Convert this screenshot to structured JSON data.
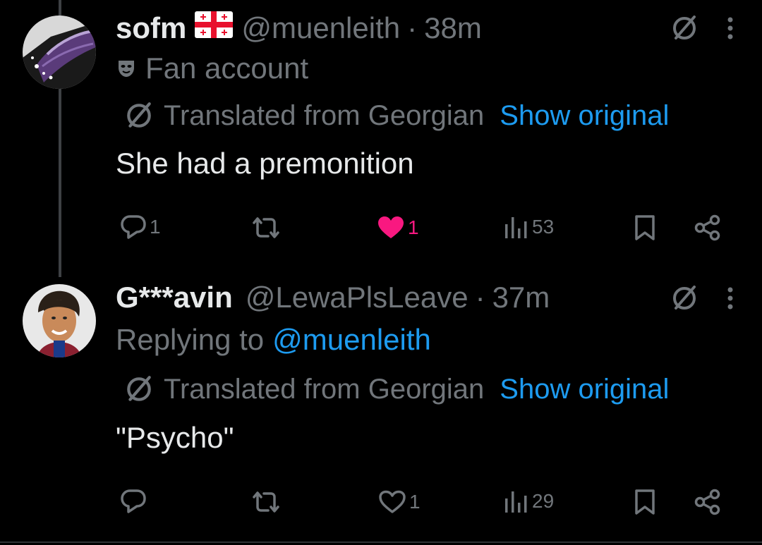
{
  "tweets": [
    {
      "name": "sofm",
      "handle": "@muenleith",
      "time": "38m",
      "badge_label": "Fan account",
      "translated": "Translated from Georgian",
      "show_original": "Show original",
      "text": "She had a premonition",
      "replies": "1",
      "retweets": "",
      "likes": "1",
      "liked": true,
      "views": "53"
    },
    {
      "name": "G***avin",
      "handle": "@LewaPlsLeave",
      "time": "37m",
      "replying_prefix": "Replying to",
      "replying_to": "@muenleith",
      "translated": "Translated from Georgian",
      "show_original": "Show original",
      "text": "\"Psycho\"",
      "replies": "",
      "retweets": "",
      "likes": "1",
      "liked": false,
      "views": "29"
    }
  ],
  "separator": "·",
  "colors": {
    "accent": "#1d9bf0",
    "like": "#f91880",
    "muted": "#71767b",
    "text": "#e7e9ea",
    "background": "#000000"
  }
}
